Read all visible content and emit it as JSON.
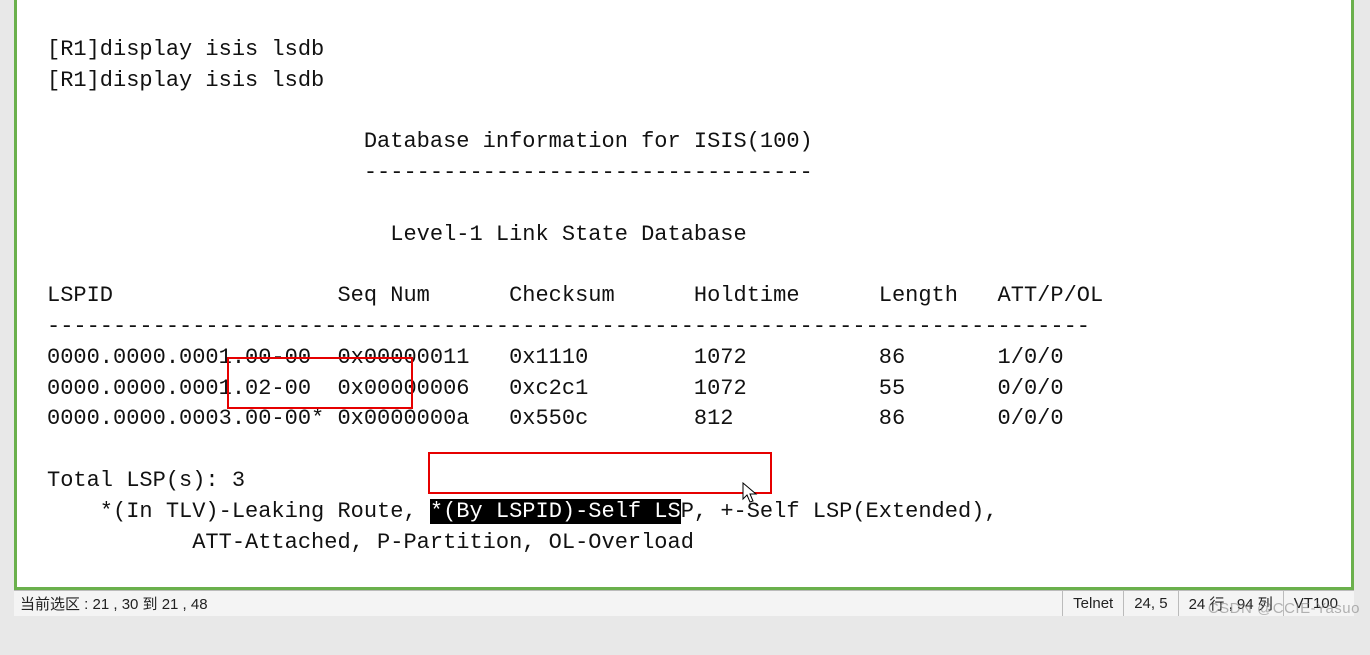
{
  "terminal": {
    "cmd1": "[R1]display isis lsdb",
    "cmd2": "[R1]display isis lsdb",
    "heading1": "                        Database information for ISIS(100)",
    "heading1_ul": "                        ----------------------------------",
    "heading2": "                          Level-1 Link State Database",
    "columns": "LSPID                 Seq Num      Checksum      Holdtime      Length   ATT/P/OL",
    "col_ul": "-------------------------------------------------------------------------------",
    "row1": "0000.0000.0001.00-00  0x00000011   0x1110        1072          86       1/0/0",
    "row2": "0000.0000.0001.02-00  0x00000006   0xc2c1        1072          55       0/0/0",
    "row3": "0000.0000.0003.00-00* 0x0000000a   0x550c        812           86       0/0/0",
    "total": "Total LSP(s): 3",
    "legend1_pre": "    *(In TLV)-Leaking Route, ",
    "legend1_sel": "*(By LSPID)-Self LS",
    "legend1_post": "P, +-Self LSP(Extended),",
    "legend2": "           ATT-Attached, P-Partition, OL-Overload",
    "prompt": "[R1]"
  },
  "status": {
    "selection": "当前选区 : 21 , 30 到 21 , 48",
    "protocol": "Telnet",
    "cursor": "24,  5",
    "size": "24 行 , 94 列",
    "term": "VT100"
  },
  "watermark": "CSDN @CCIE-Yasuo"
}
